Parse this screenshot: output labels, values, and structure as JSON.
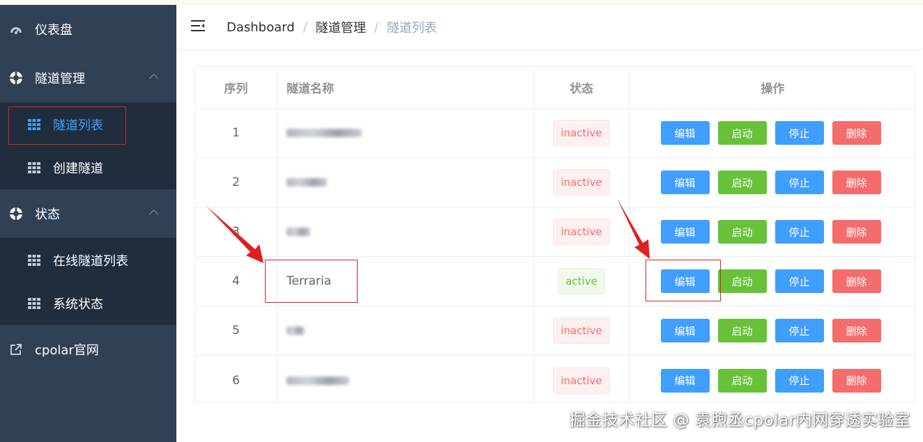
{
  "sidebar": {
    "dashboard": {
      "label": "仪表盘",
      "icon": "dashboard-gauge-icon"
    },
    "tunnel_mgmt": {
      "label": "隧道管理",
      "icon": "lifebuoy-icon",
      "children": [
        {
          "label": "隧道列表",
          "icon": "grid-icon",
          "active": true
        },
        {
          "label": "创建隧道",
          "icon": "grid-icon"
        }
      ]
    },
    "status": {
      "label": "状态",
      "icon": "lifebuoy-icon",
      "children": [
        {
          "label": "在线隧道列表",
          "icon": "grid-icon"
        },
        {
          "label": "系统状态",
          "icon": "grid-icon"
        }
      ]
    },
    "official": {
      "label": "cpolar官网",
      "icon": "external-link-icon"
    }
  },
  "header": {
    "breadcrumb": [
      "Dashboard",
      "隧道管理",
      "隧道列表"
    ],
    "separator": "/"
  },
  "table": {
    "columns": [
      "序列",
      "隧道名称",
      "状态",
      "操作"
    ],
    "rows": [
      {
        "index": "1",
        "name": "",
        "name_obscured": true,
        "status": "inactive"
      },
      {
        "index": "2",
        "name": "",
        "name_obscured": true,
        "status": "inactive"
      },
      {
        "index": "3",
        "name": "",
        "name_obscured": true,
        "status": "inactive"
      },
      {
        "index": "4",
        "name": "Terraria",
        "name_obscured": false,
        "status": "active"
      },
      {
        "index": "5",
        "name": "",
        "name_obscured": true,
        "status": "inactive"
      },
      {
        "index": "6",
        "name": "",
        "name_obscured": true,
        "status": "inactive"
      }
    ],
    "actions": {
      "edit": "编辑",
      "start": "启动",
      "stop": "停止",
      "delete": "删除"
    }
  },
  "watermark": "掘金技术社区 @ 袁煦丞cpolar内网穿透实验室",
  "colors": {
    "sidebar_bg": "#304156",
    "submenu_bg": "#1f2d3d",
    "active_text": "#409eff",
    "primary": "#409eff",
    "success": "#67c23a",
    "danger": "#f56c6c",
    "annotation": "#e02020"
  }
}
